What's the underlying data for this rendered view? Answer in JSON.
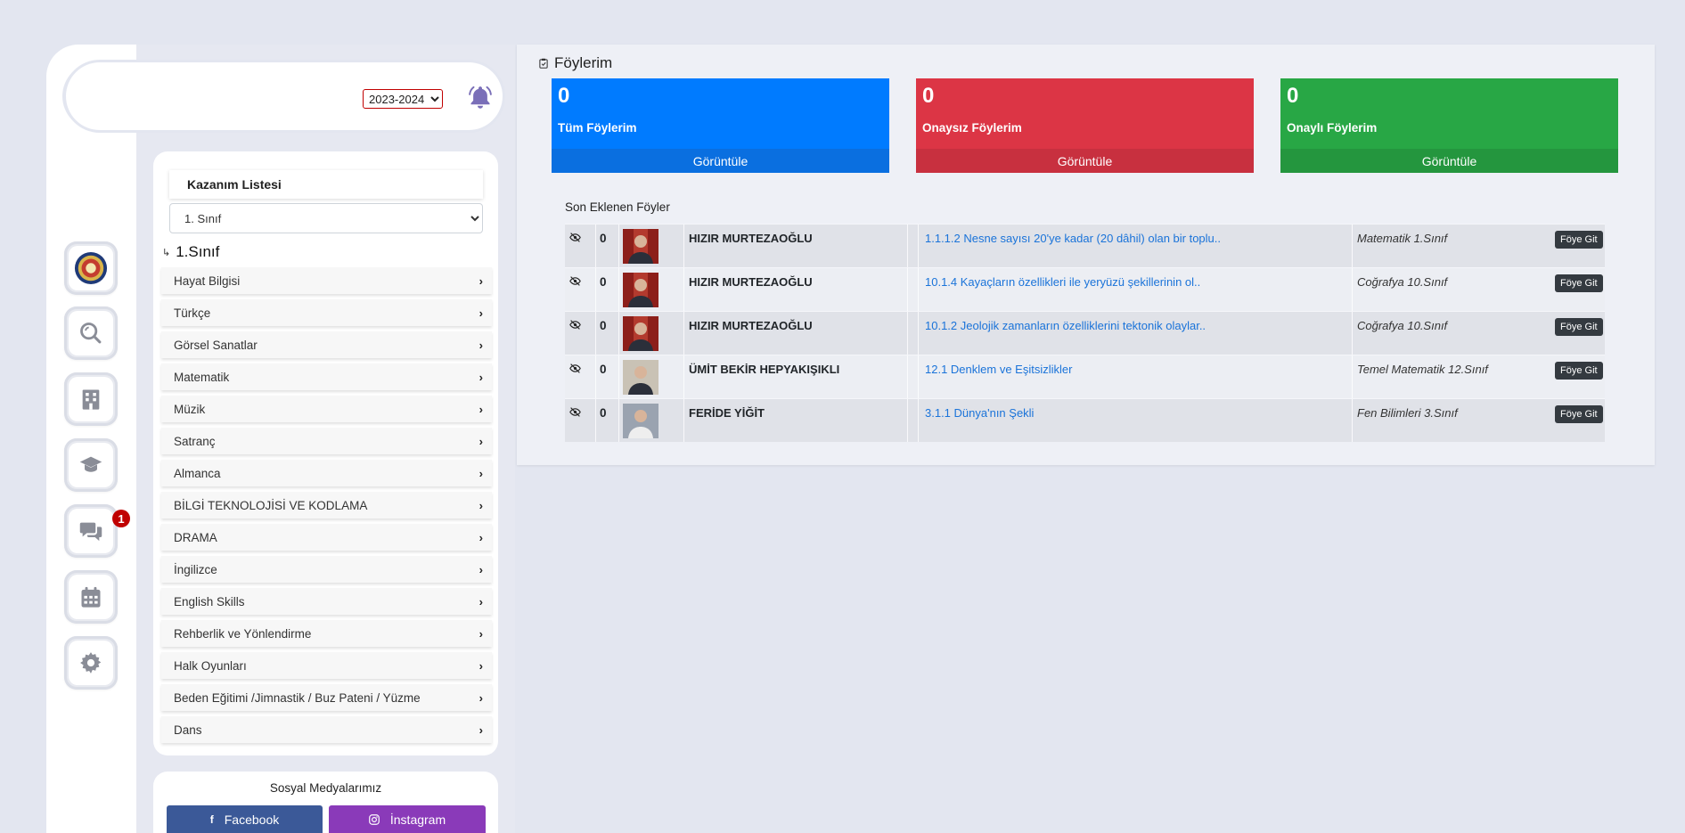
{
  "header": {
    "year_select_value": "2023-2024",
    "bell_icon": "bell-icon"
  },
  "rail": {
    "items": [
      {
        "name": "school-logo",
        "icon": "school-logo-icon"
      },
      {
        "name": "search",
        "icon": "search-icon"
      },
      {
        "name": "institution",
        "icon": "building-icon"
      },
      {
        "name": "education",
        "icon": "graduation-cap-icon"
      },
      {
        "name": "messages",
        "icon": "comments-icon",
        "badge": "1"
      },
      {
        "name": "calendar",
        "icon": "calendar-icon"
      },
      {
        "name": "settings",
        "icon": "gear-icon"
      }
    ]
  },
  "kazanim": {
    "title": "Kazanım Listesi",
    "class_select_value": "1. Sınıf",
    "grade_heading": "1.Sınıf",
    "subjects": [
      "Hayat Bilgisi",
      "Türkçe",
      "Görsel Sanatlar",
      "Matematik",
      "Müzik",
      "Satranç",
      "Almanca",
      "BİLGİ TEKNOLOJİSİ VE KODLAMA",
      "DRAMA",
      "İngilizce",
      "English Skills",
      "Rehberlik ve Yönlendirme",
      "Halk Oyunları",
      "Beden Eğitimi /Jimnastik / Buz Pateni / Yüzme",
      "Dans"
    ]
  },
  "social": {
    "title": "Sosyal Medyalarımız",
    "facebook_label": "Facebook",
    "instagram_label": "İnstagram"
  },
  "foylerim": {
    "title": "Föylerim",
    "cards": [
      {
        "count": "0",
        "label": "Tüm Föylerim",
        "footer": "Görüntüle",
        "color": "#007bff",
        "footer_color": "#0a6fe0"
      },
      {
        "count": "0",
        "label": "Onaysız Föylerim",
        "footer": "Görüntüle",
        "color": "#dc3545",
        "footer_color": "#c8303f"
      },
      {
        "count": "0",
        "label": "Onaylı Föylerim",
        "footer": "Görüntüle",
        "color": "#28a745",
        "footer_color": "#24963e"
      }
    ]
  },
  "recent": {
    "title": "Son Eklenen Föyler",
    "button_label": "Föye Git",
    "rows": [
      {
        "views": "0",
        "author": "HIZIR MURTEZAOĞLU",
        "title": "1.1.1.2 Nesne sayısı 20'ye kadar (20 dâhil) olan bir toplu..",
        "class": "Matematik 1.Sınıf"
      },
      {
        "views": "0",
        "author": "HIZIR MURTEZAOĞLU",
        "title": "10.1.4 Kayaçların özellikleri ile yeryüzü şekillerinin ol..",
        "class": "Coğrafya 10.Sınıf"
      },
      {
        "views": "0",
        "author": "HIZIR MURTEZAOĞLU",
        "title": "10.1.2 Jeolojik zamanların özelliklerini tektonik olaylar..",
        "class": "Coğrafya 10.Sınıf"
      },
      {
        "views": "0",
        "author": "ÜMİT BEKİR HEPYAKIŞIKLI",
        "title": "12.1 Denklem ve Eşitsizlikler",
        "class": "Temel Matematik 12.Sınıf"
      },
      {
        "views": "0",
        "author": "FERİDE YİĞİT",
        "title": "3.1.1 Dünya'nın Şekli",
        "class": "Fen Bilimleri 3.Sınıf"
      }
    ]
  }
}
